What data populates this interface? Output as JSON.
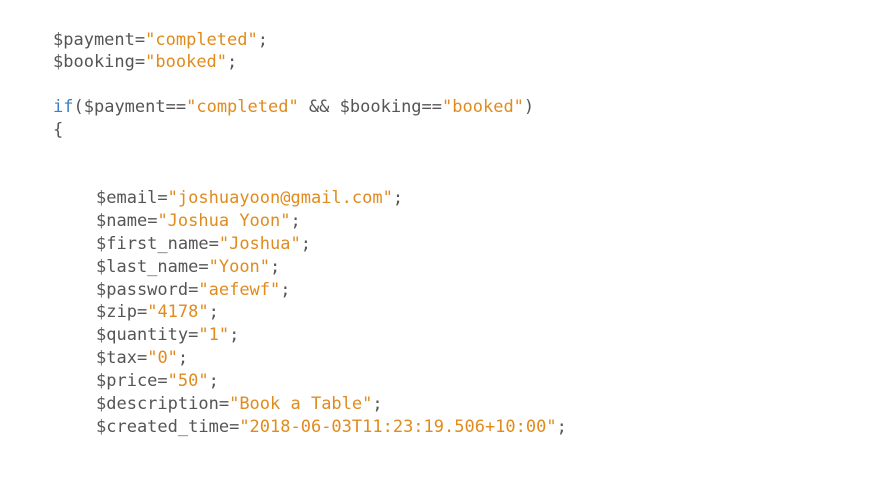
{
  "code": {
    "line1": {
      "var": "$payment",
      "op": "=",
      "str": "\"completed\"",
      "end": ";"
    },
    "line2": {
      "var": "$booking",
      "op": "=",
      "str": "\"booked\"",
      "end": ";"
    },
    "line3": {
      "kw": "if",
      "open": "(",
      "var1": "$payment",
      "op1": "==",
      "str1": "\"completed\"",
      "and": " && ",
      "var2": "$booking",
      "op2": "==",
      "str2": "\"booked\"",
      "close": ")"
    },
    "line4": {
      "brace": "{"
    },
    "assignments": [
      {
        "var": "$email",
        "op": "=",
        "str": "\"joshuayoon@gmail.com\"",
        "end": ";"
      },
      {
        "var": "$name",
        "op": "=",
        "str": "\"Joshua Yoon\"",
        "end": ";"
      },
      {
        "var": "$first_name",
        "op": "=",
        "str": "\"Joshua\"",
        "end": ";"
      },
      {
        "var": "$last_name",
        "op": "=",
        "str": "\"Yoon\"",
        "end": ";"
      },
      {
        "var": "$password",
        "op": "=",
        "str": "\"aefewf\"",
        "end": ";"
      },
      {
        "var": "$zip",
        "op": "=",
        "str": "\"4178\"",
        "end": ";"
      },
      {
        "var": "$quantity",
        "op": "=",
        "str": "\"1\"",
        "end": ";"
      },
      {
        "var": "$tax",
        "op": "=",
        "str": "\"0\"",
        "end": ";"
      },
      {
        "var": "$price",
        "op": "=",
        "str": "\"50\"",
        "end": ";"
      },
      {
        "var": "$description",
        "op": "=",
        "str": "\"Book a Table\"",
        "end": ";"
      },
      {
        "var": "$created_time",
        "op": "=",
        "str": "\"2018-06-03T11:23:19.506+10:00\"",
        "end": ";"
      }
    ]
  },
  "colors": {
    "text": "#555555",
    "string": "#e08b1e",
    "keyword": "#3d7fc4",
    "background": "#ffffff"
  }
}
